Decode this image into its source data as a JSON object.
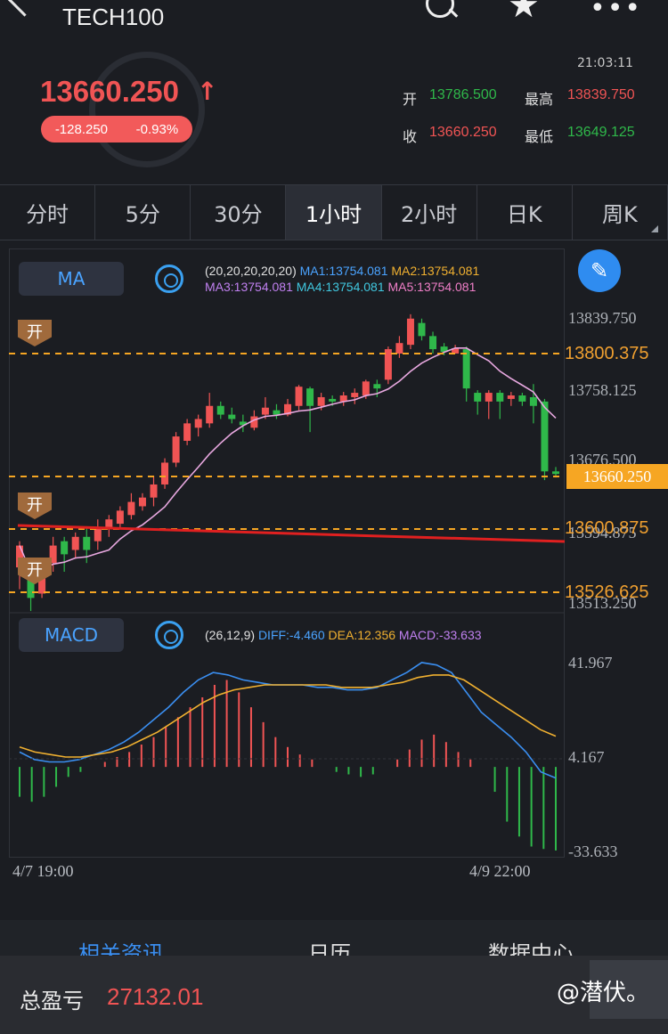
{
  "header": {
    "title": "TECH100",
    "price": "13660.250",
    "price_arrow": "↑",
    "change": "-128.250",
    "change_pct": "-0.93%",
    "time": "21:03:11",
    "open_label": "开",
    "open_value": "13786.500",
    "high_label": "最高",
    "high_value": "13839.750",
    "close_label": "收",
    "close_value": "13660.250",
    "low_label": "最低",
    "low_value": "13649.125"
  },
  "tabs": [
    "分时",
    "5分",
    "30分",
    "1小时",
    "2小时",
    "日K",
    "周K"
  ],
  "active_tab": "1小时",
  "ma": {
    "badge": "MA",
    "params": "(20,20,20,20,20)",
    "ma1": "MA1:13754.081",
    "ma2": "MA2:13754.081",
    "ma3": "MA3:13754.081",
    "ma4": "MA4:13754.081",
    "ma5": "MA5:13754.081"
  },
  "price_axis": {
    "top": "13839.750",
    "upper": "13758.125",
    "mid": "13676.500",
    "lower": "13594.875",
    "bottom": "13513.250",
    "line1": "13800.375",
    "line2": "13600.875",
    "line3": "13526.625",
    "current": "13660.250"
  },
  "markers": [
    "开",
    "开",
    "开"
  ],
  "macd": {
    "badge": "MACD",
    "params": "(26,12,9)",
    "diff": "DIFF:-4.460",
    "dea": "DEA:12.356",
    "macd": "MACD:-33.633",
    "axis_top": "41.967",
    "axis_mid": "4.167",
    "axis_bottom": "-33.633"
  },
  "dates": {
    "start": "4/7 19:00",
    "end": "4/9 22:00"
  },
  "bottom_tabs": [
    "相关资讯",
    "日历",
    "数据中心"
  ],
  "profit": {
    "label": "总盈亏",
    "value": "27132.01"
  },
  "watermark": "@潜伏。",
  "colors": {
    "up": "#f05454",
    "down": "#2fb84a",
    "accent": "#3a8ef0",
    "orange": "#f6a623"
  },
  "chart_data": {
    "type": "candlestick",
    "ylim": [
      13513.25,
      13839.75
    ],
    "candles": [
      [
        13555,
        13580,
        13530,
        13585
      ],
      [
        13560,
        13520,
        13505,
        13565
      ],
      [
        13525,
        13555,
        13520,
        13560
      ],
      [
        13560,
        13580,
        13550,
        13590
      ],
      [
        13585,
        13570,
        13550,
        13590
      ],
      [
        13575,
        13590,
        13565,
        13595
      ],
      [
        13590,
        13575,
        13560,
        13600
      ],
      [
        13585,
        13600,
        13575,
        13610
      ],
      [
        13600,
        13610,
        13590,
        13615
      ],
      [
        13605,
        13620,
        13600,
        13625
      ],
      [
        13615,
        13630,
        13610,
        13640
      ],
      [
        13625,
        13635,
        13620,
        13640
      ],
      [
        13635,
        13650,
        13625,
        13660
      ],
      [
        13650,
        13675,
        13645,
        13680
      ],
      [
        13675,
        13705,
        13670,
        13710
      ],
      [
        13700,
        13720,
        13695,
        13725
      ],
      [
        13715,
        13725,
        13705,
        13730
      ],
      [
        13720,
        13740,
        13715,
        13755
      ],
      [
        13740,
        13730,
        13725,
        13745
      ],
      [
        13730,
        13725,
        13720,
        13738
      ],
      [
        13722,
        13718,
        13710,
        13730
      ],
      [
        13715,
        13728,
        13712,
        13735
      ],
      [
        13730,
        13738,
        13725,
        13750
      ],
      [
        13735,
        13730,
        13725,
        13742
      ],
      [
        13730,
        13742,
        13728,
        13748
      ],
      [
        13740,
        13762,
        13735,
        13764
      ],
      [
        13760,
        13740,
        13710,
        13762
      ],
      [
        13740,
        13750,
        13735,
        13755
      ],
      [
        13748,
        13745,
        13740,
        13752
      ],
      [
        13745,
        13752,
        13740,
        13756
      ],
      [
        13750,
        13755,
        13742,
        13760
      ],
      [
        13752,
        13768,
        13748,
        13770
      ],
      [
        13765,
        13760,
        13750,
        13770
      ],
      [
        13770,
        13805,
        13765,
        13808
      ],
      [
        13800,
        13812,
        13795,
        13820
      ],
      [
        13810,
        13840,
        13805,
        13845
      ],
      [
        13835,
        13820,
        13815,
        13840
      ],
      [
        13820,
        13805,
        13800,
        13825
      ],
      [
        13808,
        13802,
        13798,
        13812
      ],
      [
        13800,
        13806,
        13800,
        13810
      ],
      [
        13805,
        13760,
        13745,
        13808
      ],
      [
        13755,
        13745,
        13730,
        13758
      ],
      [
        13745,
        13755,
        13725,
        13758
      ],
      [
        13755,
        13745,
        13725,
        13758
      ],
      [
        13748,
        13752,
        13740,
        13756
      ],
      [
        13752,
        13745,
        13740,
        13755
      ],
      [
        13750,
        13740,
        13720,
        13765
      ],
      [
        13745,
        13665,
        13655,
        13748
      ],
      [
        13665,
        13662,
        13658,
        13670
      ]
    ],
    "macd_hist": [
      -12,
      -14,
      -12,
      -8,
      -4,
      -2,
      0,
      2,
      4,
      6,
      9,
      12,
      16,
      20,
      24,
      28,
      33,
      35,
      30,
      24,
      18,
      12,
      8,
      5,
      3,
      0,
      -2,
      -3,
      -4,
      -3,
      0,
      3,
      7,
      11,
      13,
      10,
      6,
      3,
      0,
      -10,
      -22,
      -28,
      -32,
      -33,
      -33.6
    ],
    "diff": [
      6,
      3,
      2,
      2,
      3,
      5,
      7,
      10,
      14,
      19,
      24,
      30,
      35,
      38,
      37,
      35,
      34,
      33,
      33,
      33,
      32,
      32,
      31,
      31,
      32,
      35,
      38,
      42,
      41,
      38,
      30,
      22,
      17,
      12,
      6,
      -2,
      -4.46
    ],
    "dea": [
      8,
      6,
      5,
      4,
      4,
      5,
      6,
      8,
      11,
      14,
      18,
      22,
      26,
      29,
      31,
      32,
      33,
      33,
      33,
      33,
      33,
      32,
      32,
      32,
      33,
      34,
      36,
      37,
      37,
      35,
      31,
      27,
      23,
      19,
      15,
      12.356
    ]
  }
}
